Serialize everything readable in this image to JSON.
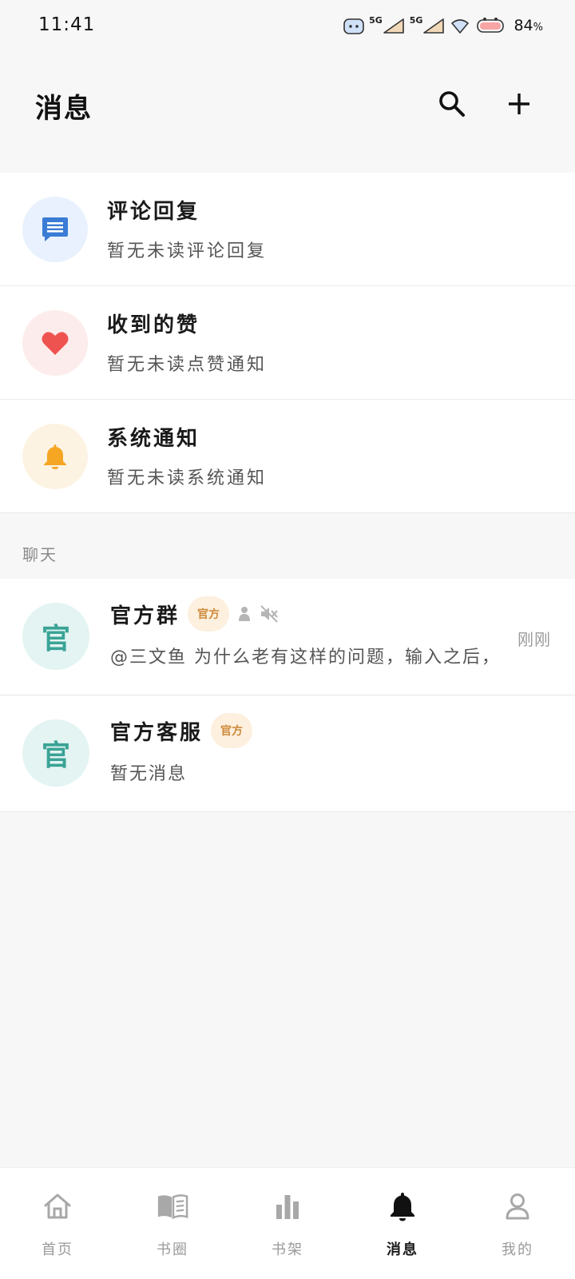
{
  "status_bar": {
    "time": "11:41",
    "network_1": "5G",
    "network_2": "5G",
    "battery": "84",
    "battery_unit": "%"
  },
  "header": {
    "title": "消息"
  },
  "notifications": [
    {
      "title": "评论回复",
      "subtitle": "暂无未读评论回复",
      "icon": "comment-icon",
      "color": "#3a7bd5",
      "bg": "#e8f1fd"
    },
    {
      "title": "收到的赞",
      "subtitle": "暂无未读点赞通知",
      "icon": "heart-icon",
      "color": "#ef5350",
      "bg": "#fdecec"
    },
    {
      "title": "系统通知",
      "subtitle": "暂无未读系统通知",
      "icon": "bell-icon",
      "color": "#f5a623",
      "bg": "#fdf3e3"
    }
  ],
  "chat_section": {
    "label": "聊天"
  },
  "chats": [
    {
      "avatar": "官",
      "name": "官方群",
      "badge": "官方",
      "message": "@三文鱼 为什么老有这样的问题，输入之后，",
      "time": "刚刚",
      "muted": true
    },
    {
      "avatar": "官",
      "name": "官方客服",
      "badge": "官方",
      "message": "暂无消息"
    }
  ],
  "bottom_nav": [
    {
      "label": "首页",
      "icon": "home-icon"
    },
    {
      "label": "书圈",
      "icon": "book-icon"
    },
    {
      "label": "书架",
      "icon": "bar-chart-icon"
    },
    {
      "label": "消息",
      "icon": "bell-icon",
      "active": true
    },
    {
      "label": "我的",
      "icon": "user-icon"
    }
  ],
  "colors": {
    "background": "#f7f7f7",
    "badge_bg": "#fdf0df",
    "badge_text": "#cc8a3a",
    "avatar_bg": "#e3f4f2",
    "avatar_text": "#3aa396"
  }
}
